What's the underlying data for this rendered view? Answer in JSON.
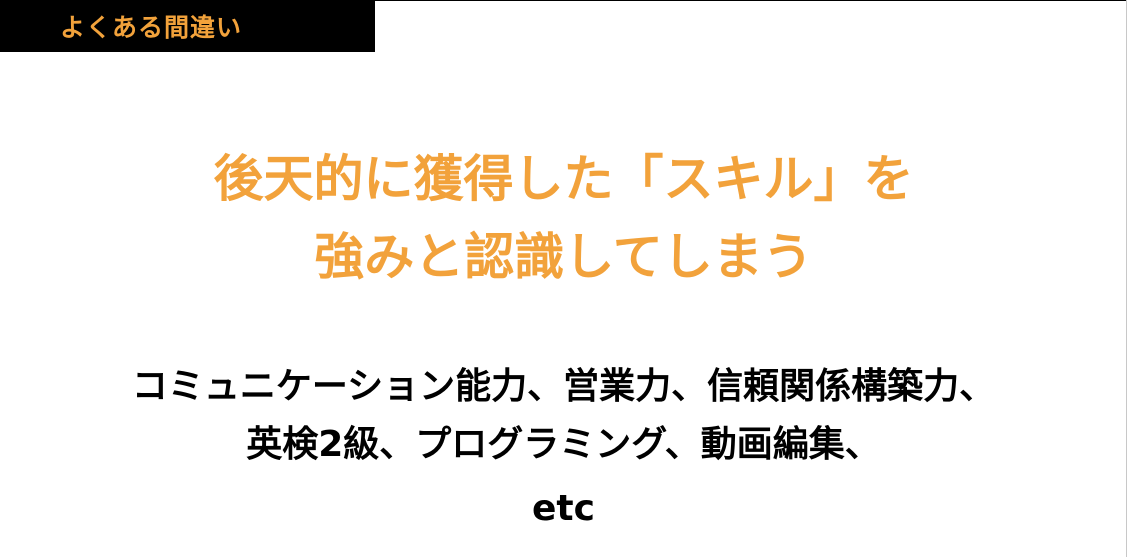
{
  "header": {
    "label": "よくある間違い"
  },
  "headline": {
    "line1": "後天的に獲得した「スキル」を",
    "line2": "強みと認識してしまう"
  },
  "examples": {
    "line1": "コミュニケーション能力、営業力、信頼関係構築力、",
    "line2": "英検2級、プログラミング、動画編集、",
    "line3": "etc"
  },
  "colors": {
    "accent": "#f2a23b",
    "header_background": "#000000",
    "body_text": "#000000",
    "background": "#ffffff"
  }
}
